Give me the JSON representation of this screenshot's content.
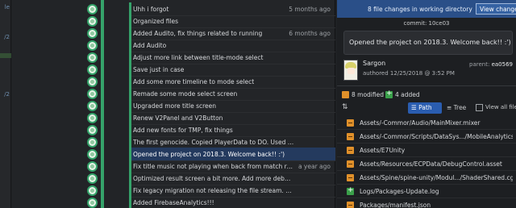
{
  "gutter": {
    "labels": [
      "le",
      "/2",
      "/2"
    ]
  },
  "commits": [
    {
      "message": "Uhh i forgot",
      "ago": "5 months ago"
    },
    {
      "message": "Organized files",
      "ago": ""
    },
    {
      "message": "Added Audito, fix things related to running",
      "ago": "6 months ago"
    },
    {
      "message": "Add Audito",
      "ago": ""
    },
    {
      "message": "Adjust more link between title-mode select",
      "ago": ""
    },
    {
      "message": "Save just in case",
      "ago": ""
    },
    {
      "message": "Add some more timeline to mode select",
      "ago": ""
    },
    {
      "message": "Remade some mode select screen",
      "ago": ""
    },
    {
      "message": "Upgraded more title screen",
      "ago": ""
    },
    {
      "message": "Renew V2Panel and V2Button",
      "ago": ""
    },
    {
      "message": "Add new fonts for TMP, fix things",
      "ago": ""
    },
    {
      "message": "The first genocide. Copied PlayerData to DO. Used Packages. Upgraded plugins. ...",
      "ago": ""
    },
    {
      "message": "Opened the project on 2018.3. Welcome back!! :')",
      "ago": "",
      "selected": true
    },
    {
      "message": "Fix title music not playing when back from match result.",
      "ago": "a year ago"
    },
    {
      "message": "Optimized result screen a bit more. Add more debug control tools. Updated IAP p...",
      "ago": ""
    },
    {
      "message": "Fix legacy migration not releasing the file stream. Fix prefab instantiator script ex...",
      "ago": ""
    },
    {
      "message": "Added FirebaseAnalytics!!!",
      "ago": ""
    }
  ],
  "panel": {
    "wip_text": "8 file changes in working directory",
    "view_changes": "View changes",
    "commit_label": "commit: 10ce03",
    "message": "Opened the project on 2018.3. Welcome back!! :')",
    "author": "Sargon",
    "authored": "authored 12/25/2018 @ 3:52 PM",
    "parent_label": "parent:",
    "parent_id": "ea0569",
    "modified": "8 modified",
    "added": "4 added",
    "path_tab": "Path",
    "tree_tab": "Tree",
    "view_all": "View all files",
    "files": [
      {
        "status": "modified",
        "path": "Assets/-Commor/Audio/MainMixer.mixer"
      },
      {
        "status": "modified",
        "path": "Assets/-Commor/Scripts/DataSys.../MobileAnalytics.cs"
      },
      {
        "status": "modified",
        "path": "Assets/E7Unity"
      },
      {
        "status": "modified",
        "path": "Assets/Resources/ECPData/DebugControl.asset"
      },
      {
        "status": "modified",
        "path": "Assets/Spine/spine-unity/Modul.../ShaderShared.cginc"
      },
      {
        "status": "added",
        "path": "Logs/Packages-Update.log"
      },
      {
        "status": "modified",
        "path": "Packages/manifest.json"
      }
    ]
  },
  "colors": {
    "lane": "#35a36a",
    "selected_row": "#243a5e",
    "wip_bar": "#2a4f88",
    "modified": "#e0902a",
    "added": "#3aa04a"
  }
}
